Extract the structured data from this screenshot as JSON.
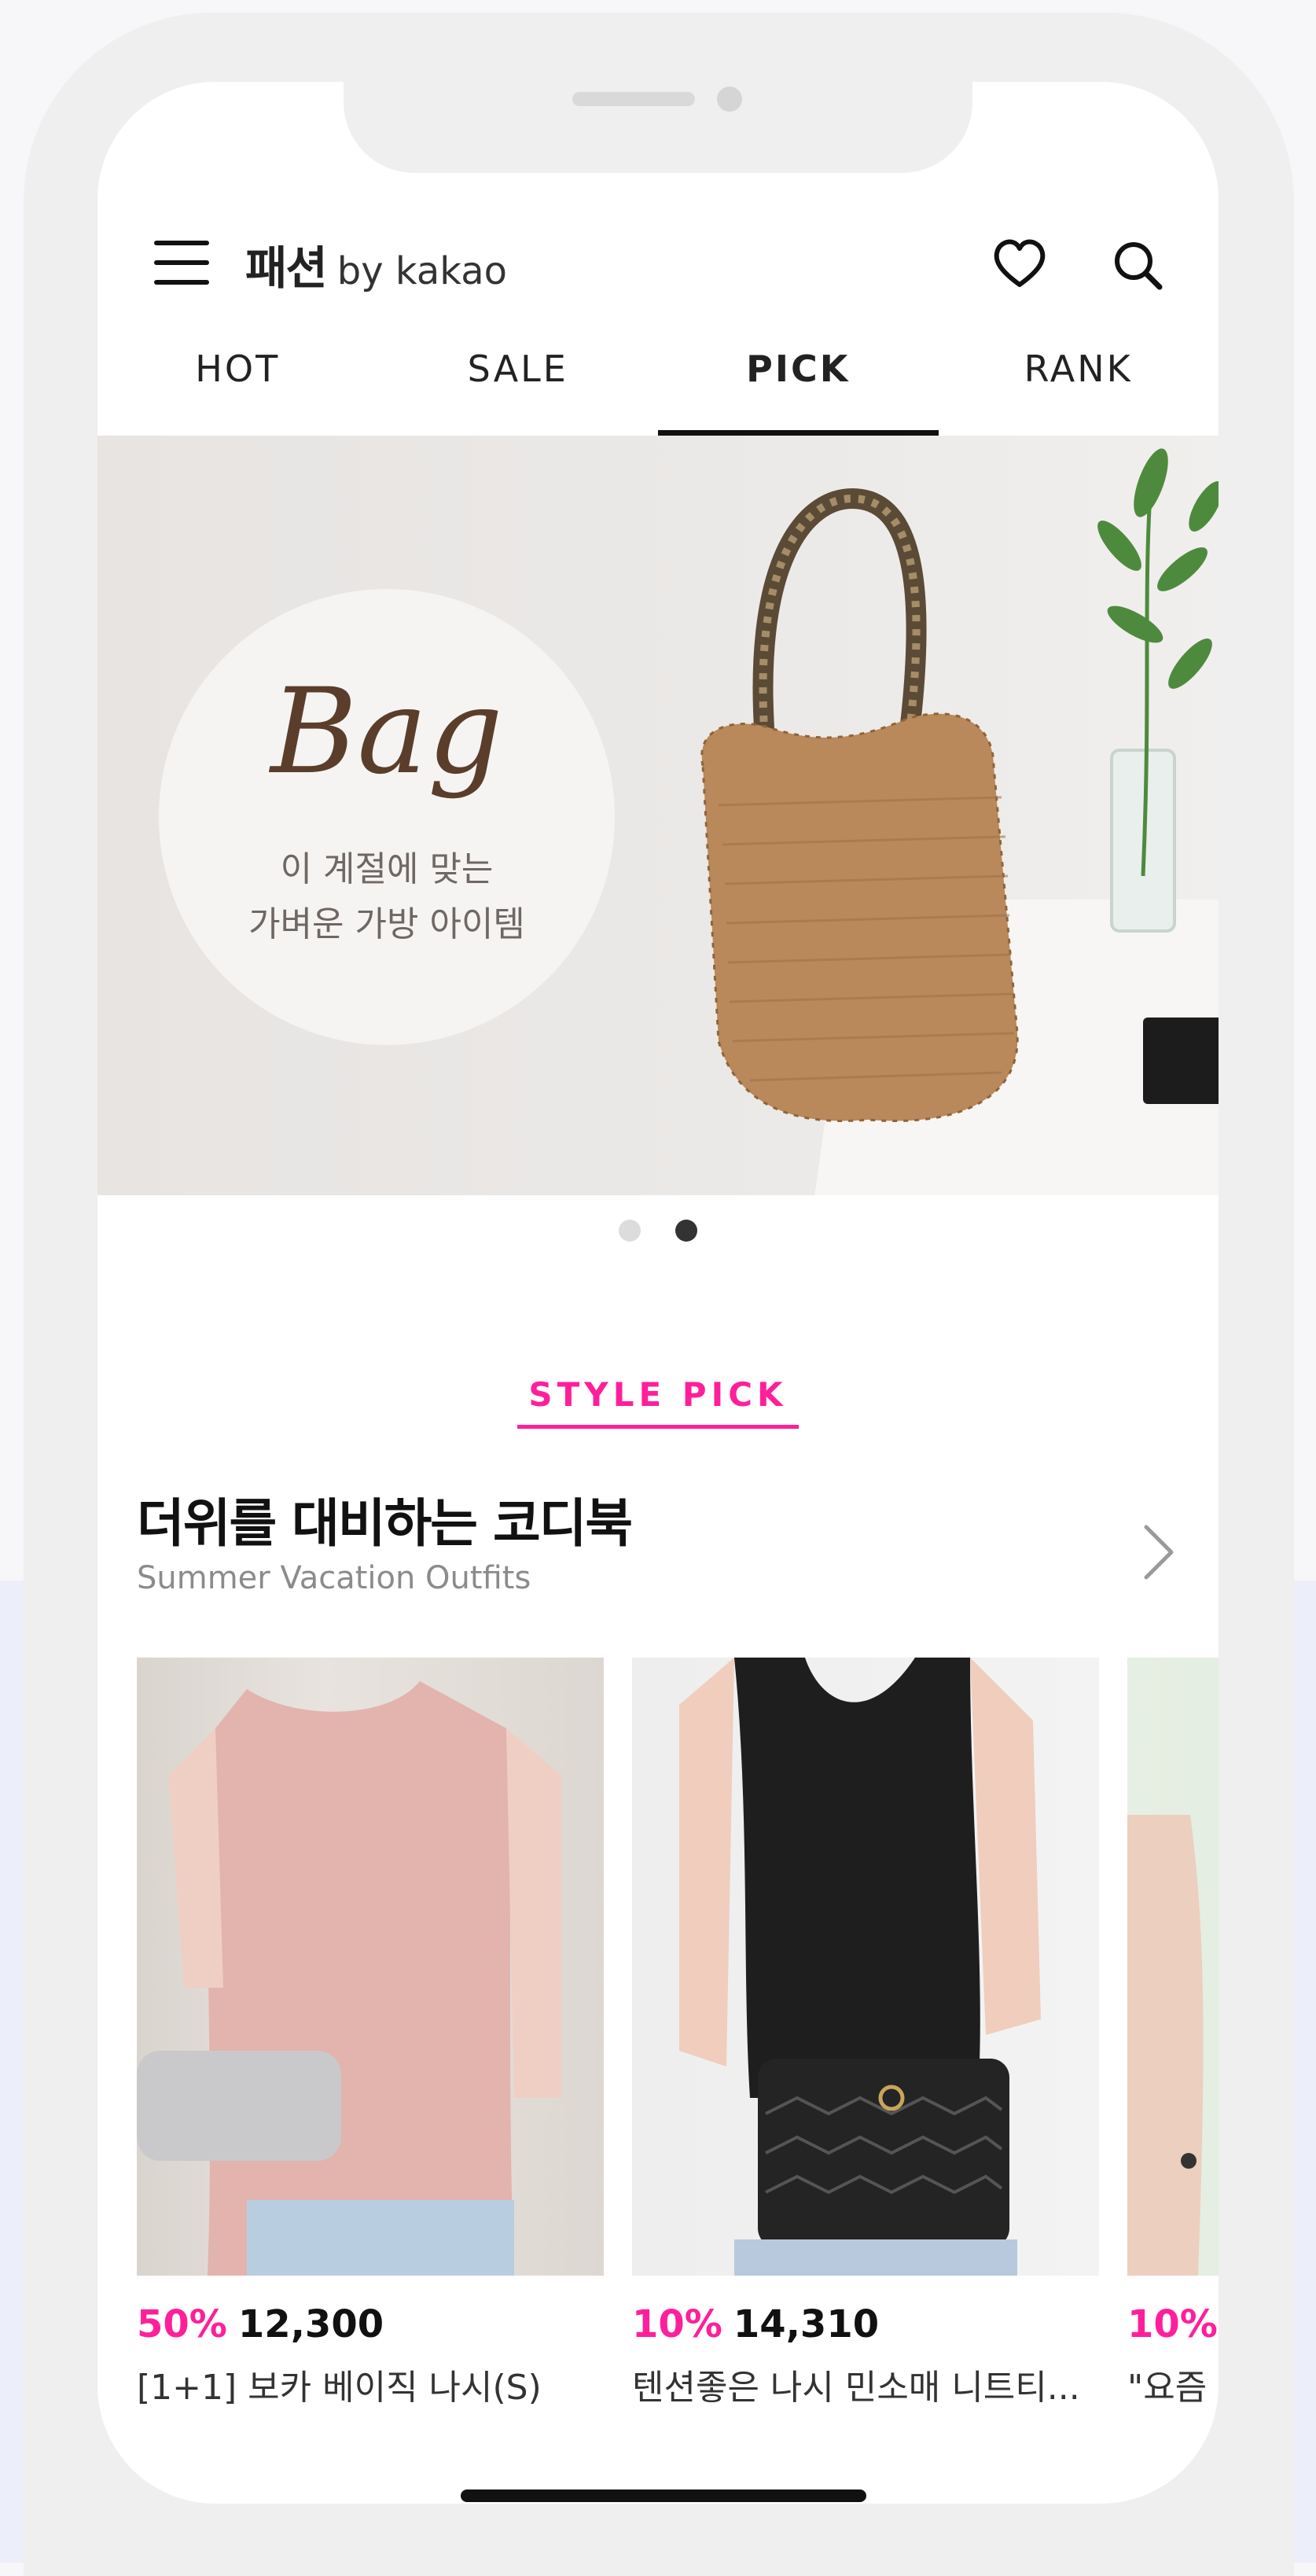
{
  "header": {
    "brand_name": "패션",
    "brand_by": "by kakao"
  },
  "tabs": [
    {
      "label": "HOT"
    },
    {
      "label": "SALE"
    },
    {
      "label": "PICK",
      "active": true
    },
    {
      "label": "RANK"
    }
  ],
  "banner": {
    "title": "Bag",
    "line1": "이 계절에 맞는",
    "line2": "가벼운 가방 아이템",
    "page_count": 2,
    "active_page": 2
  },
  "section": {
    "label": "STYLE PICK",
    "title": "더위를 대비하는 코디북",
    "subtitle": "Summer Vacation Outfits"
  },
  "products": [
    {
      "discount": "50%",
      "price": "12,300",
      "name": "[1+1] 보카 베이직 나시(S)"
    },
    {
      "discount": "10%",
      "price": "14,310",
      "name": "텐션좋은 나시 민소매 니트티..."
    },
    {
      "discount": "10%",
      "price": "",
      "name": "\"요즘"
    }
  ],
  "colors": {
    "accent": "#ff1f9a",
    "text": "#111111",
    "subtext": "#8b8b8b"
  },
  "icons": [
    "menu-icon",
    "heart-icon",
    "search-icon",
    "chevron-right-icon"
  ]
}
